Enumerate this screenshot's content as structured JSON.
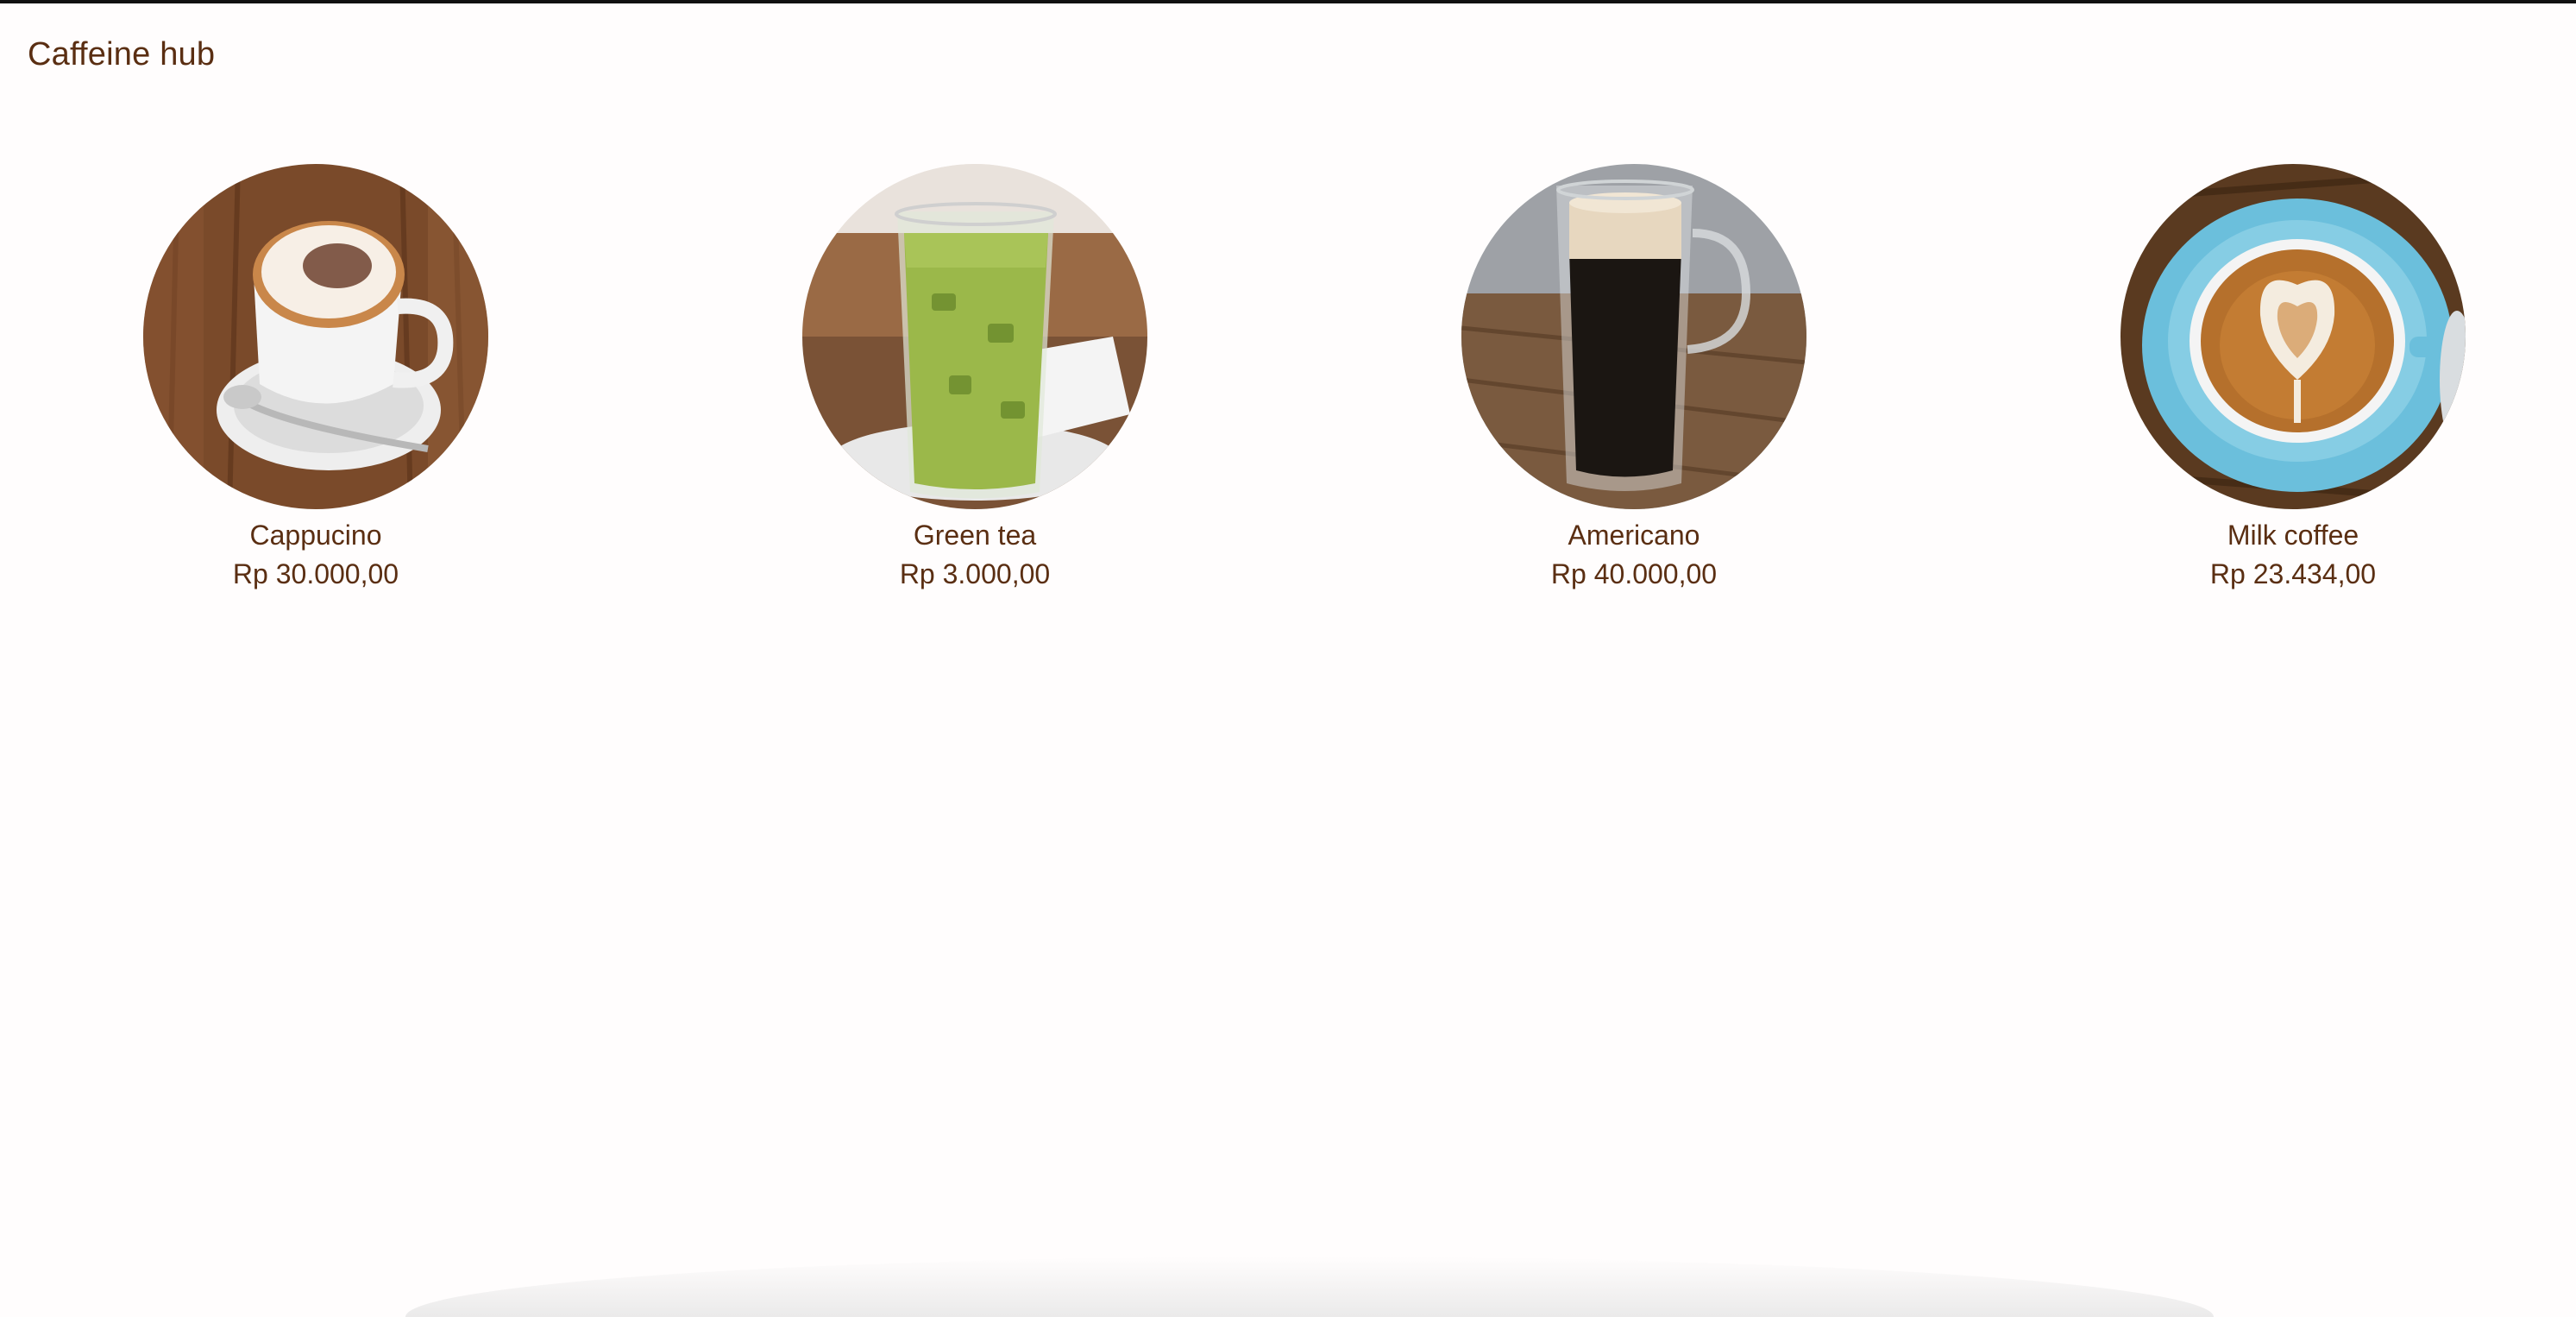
{
  "app": {
    "brand": "Caffeine hub"
  },
  "menu": {
    "items": [
      {
        "name": "Cappucino",
        "price": "Rp 30.000,00",
        "image": "cappuccino-cup-photo"
      },
      {
        "name": "Green tea",
        "price": "Rp 3.000,00",
        "image": "iced-green-tea-glass-photo"
      },
      {
        "name": "Americano",
        "price": "Rp 40.000,00",
        "image": "americano-glass-mug-photo"
      },
      {
        "name": "Milk coffee",
        "price": "Rp 23.434,00",
        "image": "latte-art-blue-cup-photo"
      }
    ]
  },
  "colors": {
    "text": "#5a2e12",
    "background": "#fffdfd",
    "top_border": "#111111"
  }
}
